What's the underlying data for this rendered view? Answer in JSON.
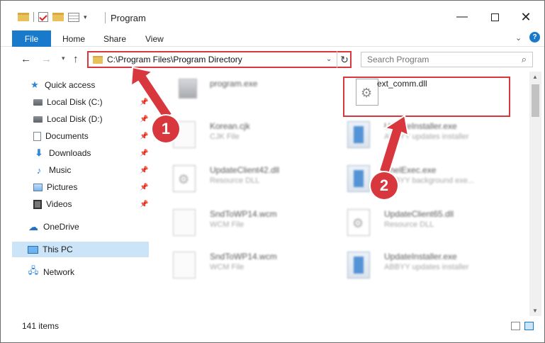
{
  "window": {
    "title": "Program",
    "minimize_label": "—",
    "close_label": "✕"
  },
  "ribbon": {
    "tabs": [
      "File",
      "Home",
      "Share",
      "View"
    ]
  },
  "navbar": {
    "address_path": "C:\\Program Files\\Program Directory",
    "search_placeholder": "Search Program"
  },
  "sidebar": {
    "items": [
      {
        "label": "Quick access",
        "icon": "star-icon"
      },
      {
        "label": "Local Disk (C:)",
        "icon": "drive-icon",
        "pinned": true
      },
      {
        "label": "Local Disk (D:)",
        "icon": "drive-icon",
        "pinned": true
      },
      {
        "label": "Documents",
        "icon": "documents-icon",
        "pinned": true
      },
      {
        "label": "Downloads",
        "icon": "download-icon",
        "pinned": true
      },
      {
        "label": "Music",
        "icon": "music-icon",
        "pinned": true
      },
      {
        "label": "Pictures",
        "icon": "pictures-icon",
        "pinned": true
      },
      {
        "label": "Videos",
        "icon": "videos-icon",
        "pinned": true
      },
      {
        "label": "OneDrive",
        "icon": "cloud-icon"
      },
      {
        "label": "This PC",
        "icon": "computer-icon",
        "selected": true
      },
      {
        "label": "Network",
        "icon": "network-icon"
      }
    ]
  },
  "files": [
    {
      "name": "program.exe",
      "type": "",
      "icon": "exe-icon",
      "blurred": true
    },
    {
      "name": "ext_comm.dll",
      "type": "",
      "icon": "dll-gear-icon",
      "blurred": false
    },
    {
      "name": "Korean.cjk",
      "type": "CJK File",
      "icon": "document-icon",
      "blurred": true
    },
    {
      "name": "UpdateInstaller.exe",
      "type": "ABBYY updates installer",
      "icon": "installer-icon",
      "blurred": true
    },
    {
      "name": "UpdateClient42.dll",
      "type": "Resource DLL",
      "icon": "dll-gear-icon",
      "blurred": true
    },
    {
      "name": "ShelExec.exe",
      "type": "ABBYY background exe...",
      "icon": "installer-icon",
      "blurred": true
    },
    {
      "name": "SndToWP14.wcm",
      "type": "WCM File",
      "icon": "document-icon",
      "blurred": true
    },
    {
      "name": "UpdateClient65.dll",
      "type": "Resource DLL",
      "icon": "dll-gear-icon",
      "blurred": true
    },
    {
      "name": "SndToWP14.wcm",
      "type": "WCM File",
      "icon": "document-icon",
      "blurred": true
    },
    {
      "name": "UpdateInstaller.exe",
      "type": "ABBYY updates installer",
      "icon": "installer-icon",
      "blurred": true
    }
  ],
  "status": {
    "item_count": "141 items"
  },
  "annotations": {
    "step1": "1",
    "step2": "2",
    "color": "#d9373e"
  }
}
